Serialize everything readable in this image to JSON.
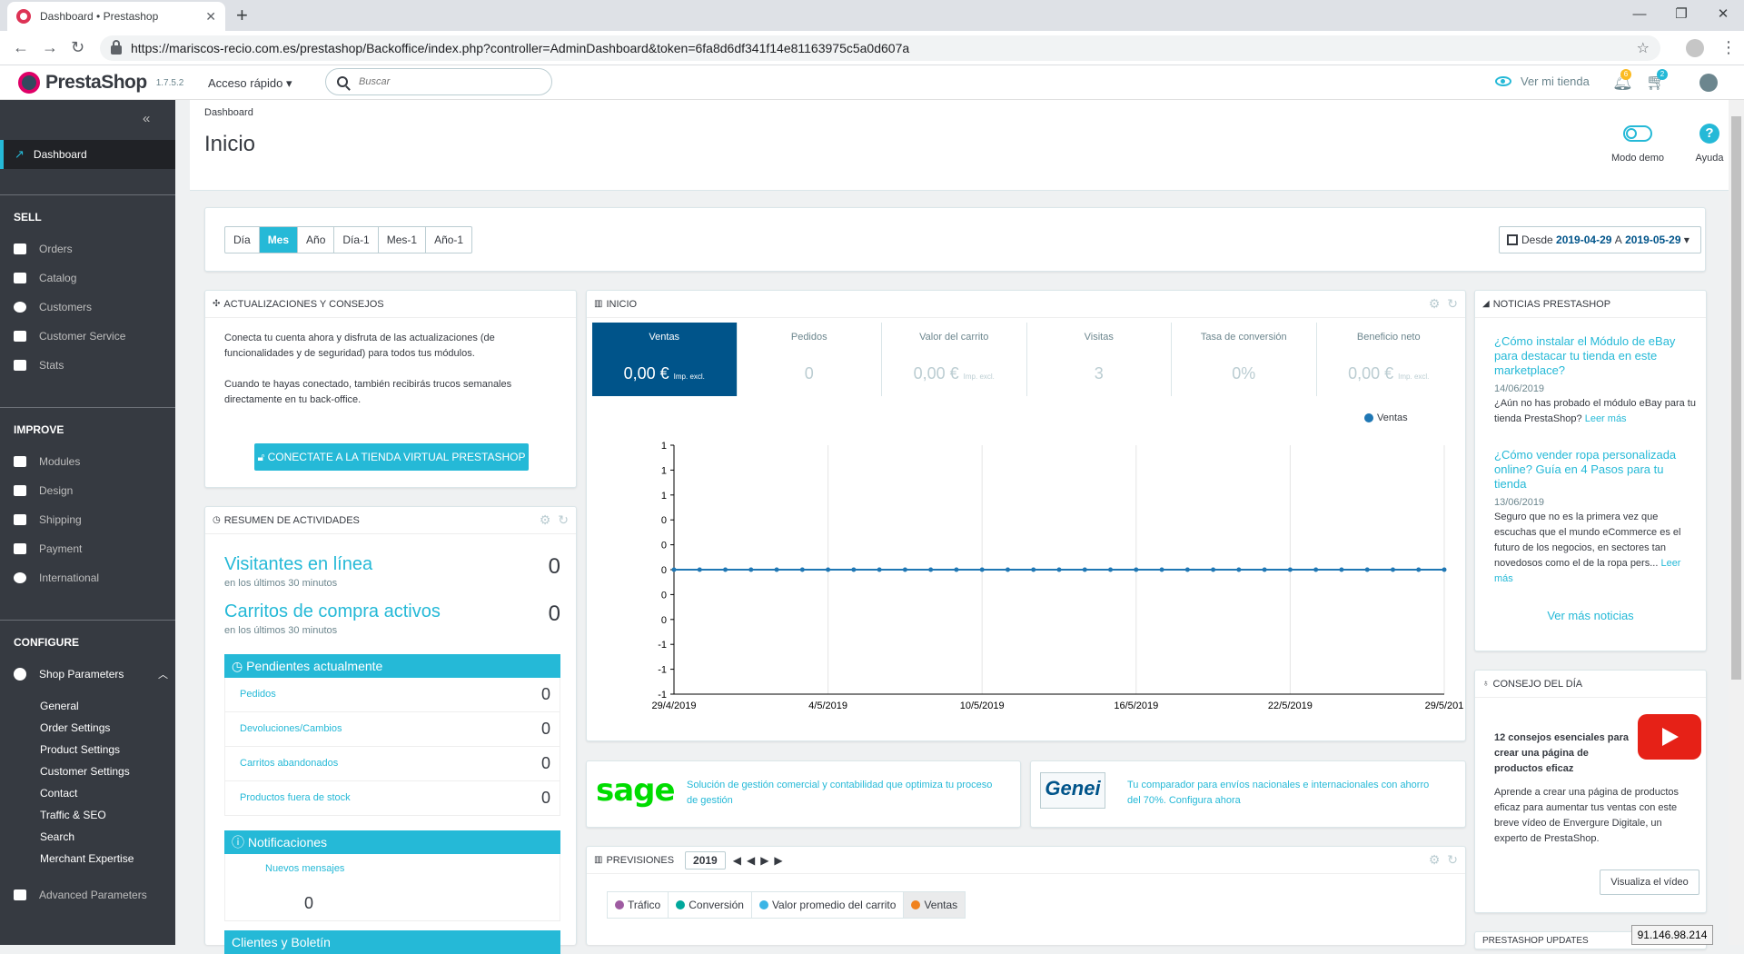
{
  "browser": {
    "tab_title": "Dashboard • Prestashop",
    "url": "https://mariscos-recio.com.es/prestashop/Backoffice/index.php?controller=AdminDashboard&token=6fa8d6df341f14e81163975c5a0d607a"
  },
  "header": {
    "brand": "PrestaShop",
    "version": "1.7.5.2",
    "quick_access": "Acceso rápido ▾",
    "search_placeholder": "Buscar",
    "view_shop": "Ver mi tienda",
    "orders_badge": "6",
    "customers_badge": "2"
  },
  "sidebar": {
    "active": "Dashboard",
    "sections": {
      "sell": "SELL",
      "improve": "IMPROVE",
      "configure": "CONFIGURE"
    },
    "sell_items": [
      "Orders",
      "Catalog",
      "Customers",
      "Customer Service",
      "Stats"
    ],
    "improve_items": [
      "Modules",
      "Design",
      "Shipping",
      "Payment",
      "International"
    ],
    "shop_parameters": "Shop Parameters",
    "sub_items": [
      "General",
      "Order Settings",
      "Product Settings",
      "Customer Settings",
      "Contact",
      "Traffic & SEO",
      "Search",
      "Merchant Expertise"
    ],
    "advanced": "Advanced Parameters"
  },
  "page": {
    "breadcrumb": "Dashboard",
    "title": "Inicio",
    "demo_mode": "Modo demo",
    "help": "Ayuda"
  },
  "range": {
    "periods": [
      "Día",
      "Mes",
      "Año",
      "Día-1",
      "Mes-1",
      "Año-1"
    ],
    "active_period": "Mes",
    "from_label": "Desde",
    "from": "2019-04-29",
    "to_label": "A",
    "to": "2019-05-29"
  },
  "updates": {
    "title": "ACTUALIZACIONES Y CONSEJOS",
    "p1": "Conecta tu cuenta ahora y disfruta de las actualizaciones (de funcionalidades y de seguridad) para todos tus módulos.",
    "p2": "Cuando te hayas conectado, también recibirás trucos semanales directamente en tu back-office.",
    "button": "CONECTATE A LA TIENDA VIRTUAL PRESTASHOP"
  },
  "activity": {
    "title": "RESUMEN DE ACTIVIDADES",
    "visitors_label": "Visitantes en línea",
    "visitors_sub": "en los últimos 30 minutos",
    "visitors": "0",
    "carts_label": "Carritos de compra activos",
    "carts_sub": "en los últimos 30 minutos",
    "carts": "0",
    "pending_title": "Pendientes actualmente",
    "pending": [
      {
        "label": "Pedidos",
        "value": "0"
      },
      {
        "label": "Devoluciones/Cambios",
        "value": "0"
      },
      {
        "label": "Carritos abandonados",
        "value": "0"
      },
      {
        "label": "Productos fuera de stock",
        "value": "0"
      }
    ],
    "notif_title": "Notificaciones",
    "new_messages": "Nuevos mensajes",
    "new_messages_count": "0",
    "clients_title": "Clientes y Boletín"
  },
  "inicio": {
    "title": "INICIO",
    "kpis": [
      {
        "label": "Ventas",
        "value": "0,00 €",
        "suffix": "Imp. excl."
      },
      {
        "label": "Pedidos",
        "value": "0",
        "suffix": ""
      },
      {
        "label": "Valor del carrito",
        "value": "0,00 €",
        "suffix": "Imp. excl."
      },
      {
        "label": "Visitas",
        "value": "3",
        "suffix": ""
      },
      {
        "label": "Tasa de conversión",
        "value": "0%",
        "suffix": ""
      },
      {
        "label": "Beneficio neto",
        "value": "0,00 €",
        "suffix": "Imp. excl."
      }
    ],
    "legend": "Ventas"
  },
  "chart_data": {
    "type": "line",
    "title": "",
    "xlabel": "",
    "ylabel": "",
    "y_tick_labels": [
      "1",
      "1",
      "1",
      "0",
      "0",
      "0",
      "0",
      "0",
      "-1",
      "-1",
      "-1"
    ],
    "x_tick_labels": [
      "29/4/2019",
      "4/5/2019",
      "10/5/2019",
      "16/5/2019",
      "22/5/2019",
      "29/5/201"
    ],
    "ylim": [
      -1,
      1
    ],
    "grid": true,
    "legend_position": "top-right",
    "series": [
      {
        "name": "Ventas",
        "color": "#1f77b4",
        "x": [
          "2019-04-29",
          "2019-04-30",
          "2019-05-01",
          "2019-05-02",
          "2019-05-03",
          "2019-05-04",
          "2019-05-05",
          "2019-05-06",
          "2019-05-07",
          "2019-05-08",
          "2019-05-09",
          "2019-05-10",
          "2019-05-11",
          "2019-05-12",
          "2019-05-13",
          "2019-05-14",
          "2019-05-15",
          "2019-05-16",
          "2019-05-17",
          "2019-05-18",
          "2019-05-19",
          "2019-05-20",
          "2019-05-21",
          "2019-05-22",
          "2019-05-23",
          "2019-05-24",
          "2019-05-25",
          "2019-05-26",
          "2019-05-27",
          "2019-05-28",
          "2019-05-29"
        ],
        "values": [
          0,
          0,
          0,
          0,
          0,
          0,
          0,
          0,
          0,
          0,
          0,
          0,
          0,
          0,
          0,
          0,
          0,
          0,
          0,
          0,
          0,
          0,
          0,
          0,
          0,
          0,
          0,
          0,
          0,
          0,
          0
        ]
      }
    ]
  },
  "partners": {
    "sage_logo": "sage",
    "sage_text": "Solución de gestión comercial y contabilidad que optimiza tu proceso de gestión",
    "genei_logo": "Genei",
    "genei_text": "Tu comparador para envíos nacionales e internacionales con ahorro del 70%. Configura ahora"
  },
  "forecast": {
    "title": "PREVISIONES",
    "year": "2019",
    "metrics": [
      {
        "label": "Tráfico",
        "color": "#9e5ba1"
      },
      {
        "label": "Conversión",
        "color": "#00a89c"
      },
      {
        "label": "Valor promedio del carrito",
        "color": "#3ab5e6"
      },
      {
        "label": "Ventas",
        "color": "#f0821e"
      }
    ]
  },
  "news": {
    "title": "NOTICIAS PRESTASHOP",
    "items": [
      {
        "title": "¿Cómo instalar el Módulo de eBay para destacar tu tienda en este marketplace?",
        "date": "14/06/2019",
        "text": "¿Aún no has probado el módulo eBay para tu tienda PrestaShop?",
        "more": "Leer más"
      },
      {
        "title": "¿Cómo vender ropa personalizada online? Guía en 4 Pasos para tu tienda",
        "date": "13/06/2019",
        "text": "Seguro que no es la primera vez que escuchas que el mundo eCommerce es el futuro de los negocios, en sectores tan novedosos como el de la ropa pers...",
        "more": "Leer más"
      }
    ],
    "more_news": "Ver más noticias"
  },
  "tip": {
    "title": "CONSEJO DEL DÍA",
    "headline": "12 consejos esenciales para crear una página de productos eficaz",
    "text": "Aprende a crear una página de productos eficaz para aumentar tus ventas con este breve vídeo de Envergure Digitale, un experto de PrestaShop.",
    "button": "Visualiza el vídeo"
  },
  "updates_panel": "PRESTASHOP UPDATES",
  "ip": "91.146.98.214"
}
